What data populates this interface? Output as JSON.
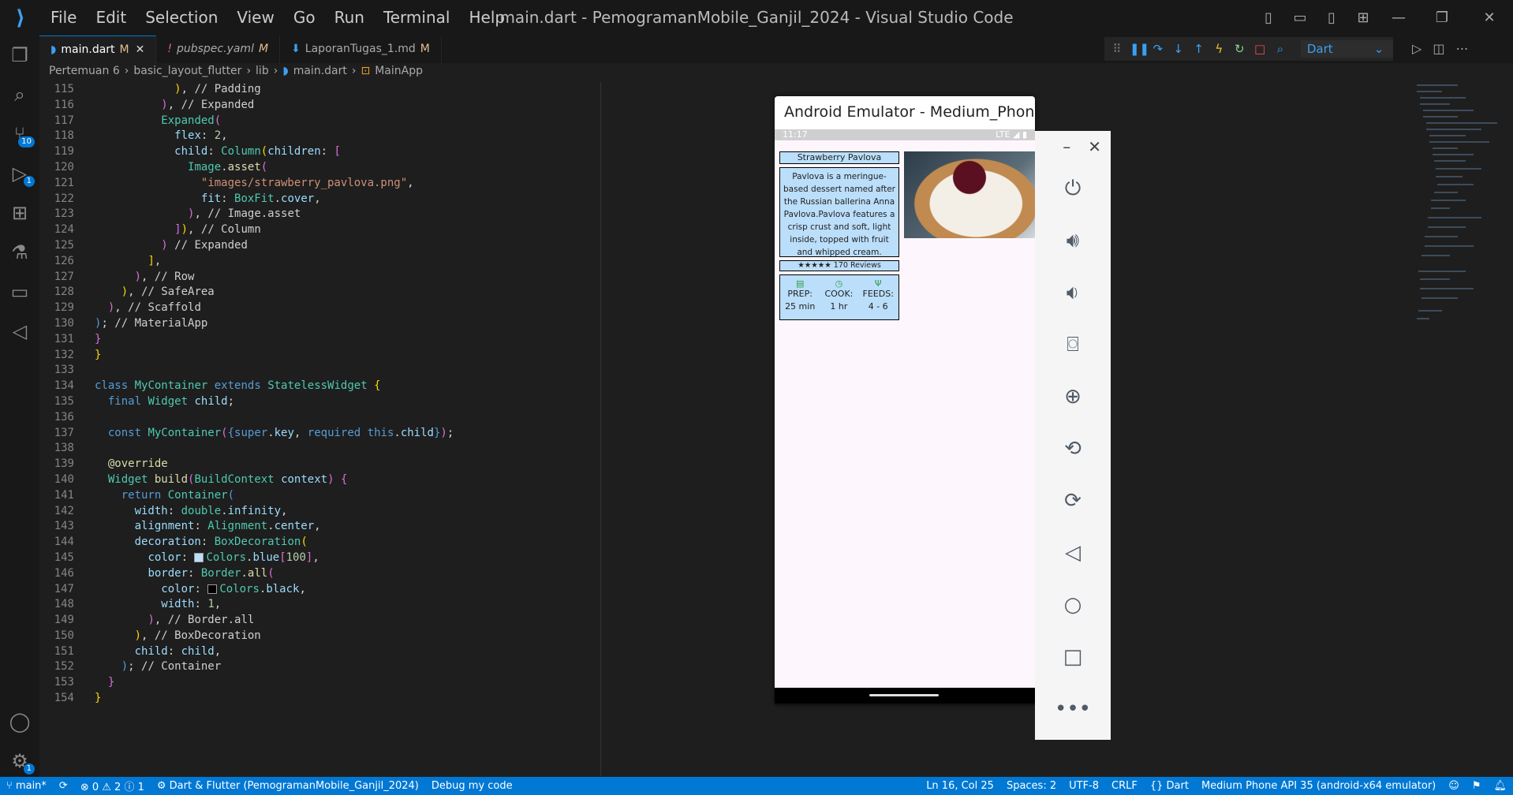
{
  "menu": [
    "File",
    "Edit",
    "Selection",
    "View",
    "Go",
    "Run",
    "Terminal",
    "Help"
  ],
  "window_title": "main.dart - PemogramanMobile_Ganjil_2024 - Visual Studio Code",
  "tabs": [
    {
      "label": "main.dart",
      "mod": "M",
      "active": true
    },
    {
      "label": "pubspec.yaml",
      "mod": "M"
    },
    {
      "label": "LaporanTugas_1.md",
      "mod": "M"
    }
  ],
  "activity_badges": {
    "scm": "10",
    "debug": "1",
    "settings": "1"
  },
  "debug_target": "Dart",
  "breadcrumb": [
    "Pertemuan 6",
    "basic_layout_flutter",
    "lib",
    "main.dart",
    "MainApp"
  ],
  "emulator": {
    "title": "Android Emulator - Medium_Phone_A...",
    "time": "11:17",
    "signal": "LTE",
    "app": {
      "title": "Strawberry Pavlova",
      "description": "Pavlova is a meringue-based dessert named after the Russian ballerina Anna Pavlova.Pavlova features a crisp crust and soft, light inside, topped with fruit and whipped cream.",
      "reviews": "★★★★★ 170 Reviews",
      "rating_stars": 5,
      "stats": [
        {
          "label": "PREP:",
          "value": "25 min"
        },
        {
          "label": "COOK:",
          "value": "1 hr"
        },
        {
          "label": "FEEDS:",
          "value": "4 - 6"
        }
      ]
    }
  },
  "statusbar": {
    "branch": "main*",
    "problems": "⊗ 0 ⚠ 2 ⓘ 1",
    "project": "Dart & Flutter (PemogramanMobile_Ganjil_2024)",
    "debug_mode": "Debug my code",
    "position": "Ln 16, Col 25",
    "spaces": "Spaces: 2",
    "encoding": "UTF-8",
    "eol": "CRLF",
    "language": "{} Dart",
    "device": "Medium Phone API 35 (android-x64 emulator)"
  },
  "code": [
    {
      "n": "115",
      "h": "            <span class='by'>)</span>, <span class='cm'>// Padding</span>"
    },
    {
      "n": "116",
      "h": "          <span class='br'>)</span>, <span class='cm'>// Expanded</span>"
    },
    {
      "n": "117",
      "h": "          <span class='ty'>Expanded</span><span class='br'>(</span>"
    },
    {
      "n": "118",
      "h": "            <span class='pr'>flex</span>: <span class='num'>2</span>,"
    },
    {
      "n": "119",
      "h": "            <span class='pr'>child</span>: <span class='ty'>Column</span><span class='by'>(</span><span class='pr'>children</span>: <span class='br'>[</span>"
    },
    {
      "n": "120",
      "h": "              <span class='ty'>Image</span>.<span class='fn'>asset</span><span class='br'>(</span>"
    },
    {
      "n": "121",
      "h": "                <span class='str'>\"images/strawberry_pavlova.png\"</span>,"
    },
    {
      "n": "122",
      "h": "                <span class='pr'>fit</span>: <span class='ty'>BoxFit</span>.<span class='pr'>cover</span>,"
    },
    {
      "n": "123",
      "h": "              <span class='br'>)</span>, <span class='cm'>// Image.asset</span>"
    },
    {
      "n": "124",
      "h": "            <span class='br'>]</span><span class='by'>)</span>, <span class='cm'>// Column</span>"
    },
    {
      "n": "125",
      "h": "          <span class='br'>)</span> <span class='cm'>// Expanded</span>"
    },
    {
      "n": "126",
      "h": "        <span class='by'>]</span>,"
    },
    {
      "n": "127",
      "h": "      <span class='br'>)</span>, <span class='cm'>// Row</span>"
    },
    {
      "n": "128",
      "h": "    <span class='by'>)</span>, <span class='cm'>// SafeArea</span>"
    },
    {
      "n": "129",
      "h": "  <span class='br'>)</span>, <span class='cm'>// Scaffold</span>"
    },
    {
      "n": "130",
      "h": "<span class='kw'>)</span>; <span class='cm'>// MaterialApp</span>"
    },
    {
      "n": "131",
      "h": "<span class='br'>}</span>"
    },
    {
      "n": "132",
      "h": "<span class='by'>}</span>"
    },
    {
      "n": "133",
      "h": ""
    },
    {
      "n": "134",
      "h": "<span class='kw'>class</span> <span class='ty'>MyContainer</span> <span class='kw'>extends</span> <span class='ty'>StatelessWidget</span> <span class='by'>{</span>"
    },
    {
      "n": "135",
      "h": "  <span class='kw'>final</span> <span class='ty'>Widget</span> <span class='pr'>child</span>;"
    },
    {
      "n": "136",
      "h": ""
    },
    {
      "n": "137",
      "h": "  <span class='kw'>const</span> <span class='ty'>MyContainer</span><span class='br'>(</span><span class='kw'>{super</span>.<span class='pr'>key</span>, <span class='kw'>required</span> <span class='kw'>this</span>.<span class='pr'>child</span><span class='kw'>}</span><span class='br'>)</span>;"
    },
    {
      "n": "138",
      "h": ""
    },
    {
      "n": "139",
      "h": "  <span class='fn'>@override</span>"
    },
    {
      "n": "140",
      "h": "  <span class='ty'>Widget</span> <span class='fn'>build</span><span class='br'>(</span><span class='ty'>BuildContext</span> <span class='pr'>context</span><span class='br'>)</span> <span class='br'>{</span>"
    },
    {
      "n": "141",
      "h": "    <span class='kw'>return</span> <span class='ty'>Container</span><span class='kw'>(</span>"
    },
    {
      "n": "142",
      "h": "      <span class='pr'>width</span>: <span class='ty'>double</span>.<span class='pr'>infinity</span>,"
    },
    {
      "n": "143",
      "h": "      <span class='pr'>alignment</span>: <span class='ty'>Alignment</span>.<span class='pr'>center</span>,"
    },
    {
      "n": "144",
      "h": "      <span class='pr'>decoration</span>: <span class='ty'>BoxDecoration</span><span class='by'>(</span>"
    },
    {
      "n": "145",
      "h": "        <span class='pr'>color</span>: <span class='sw' style='background:#bbdefb'></span><span class='ty'>Colors</span>.<span class='pr'>blue</span><span class='br'>[</span><span class='num'>100</span><span class='br'>]</span>,"
    },
    {
      "n": "146",
      "h": "        <span class='pr'>border</span>: <span class='ty'>Border</span>.<span class='fn'>all</span><span class='br'>(</span>"
    },
    {
      "n": "147",
      "h": "          <span class='pr'>color</span>: <span class='sw' style='background:#000'></span><span class='ty'>Colors</span>.<span class='pr'>black</span>,"
    },
    {
      "n": "148",
      "h": "          <span class='pr'>width</span>: <span class='num'>1</span>,"
    },
    {
      "n": "149",
      "h": "        <span class='br'>)</span>, <span class='cm'>// Border.all</span>"
    },
    {
      "n": "150",
      "h": "      <span class='by'>)</span>, <span class='cm'>// BoxDecoration</span>"
    },
    {
      "n": "151",
      "h": "      <span class='pr'>child</span>: <span class='pr'>child</span>,"
    },
    {
      "n": "152",
      "h": "    <span class='kw'>)</span>; <span class='cm'>// Container</span>"
    },
    {
      "n": "153",
      "h": "  <span class='br'>}</span>"
    },
    {
      "n": "154",
      "h": "<span class='by'>}</span>"
    }
  ]
}
